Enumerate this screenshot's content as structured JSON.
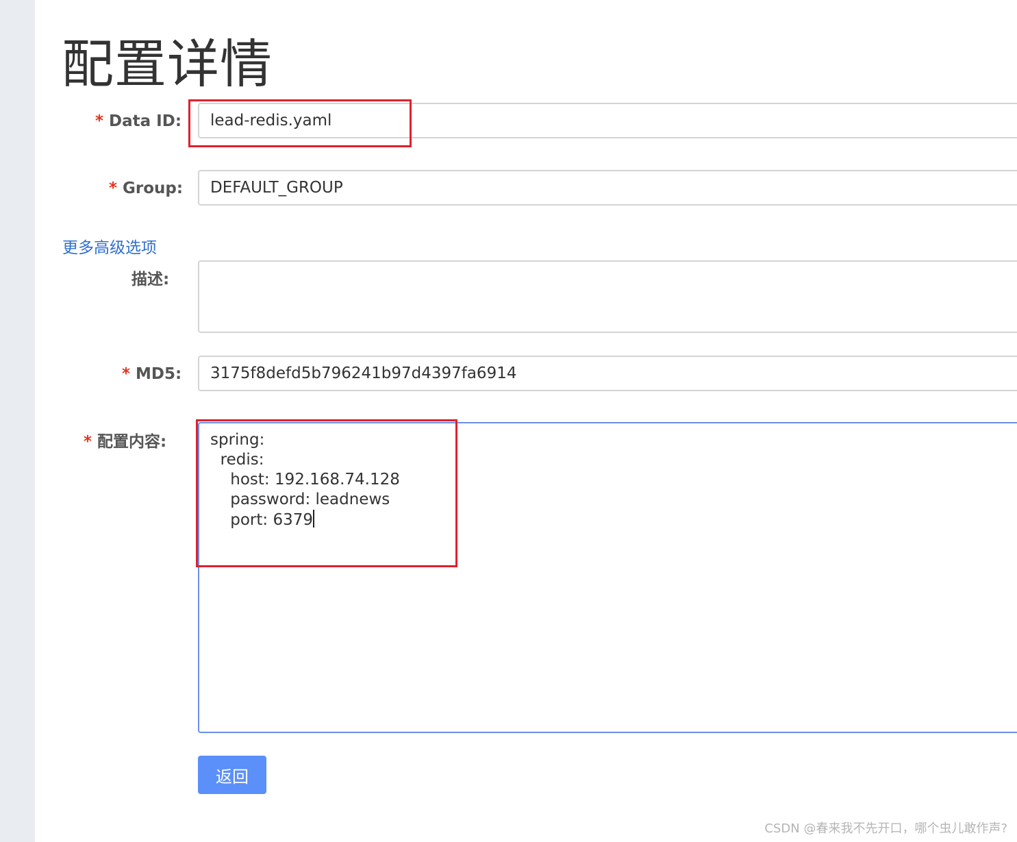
{
  "page_title": "配置详情",
  "form": {
    "data_id": {
      "required_mark": "*",
      "label": "Data ID:",
      "value": "lead-redis.yaml"
    },
    "group": {
      "required_mark": "*",
      "label": "Group:",
      "value": "DEFAULT_GROUP"
    },
    "advanced_link": "更多高级选项",
    "description": {
      "label": "描述:",
      "value": ""
    },
    "md5": {
      "required_mark": "*",
      "label": "MD5:",
      "value": "3175f8defd5b796241b97d4397fa6914"
    },
    "content": {
      "required_mark": "*",
      "label": "配置内容:",
      "lines": [
        "spring:",
        "  redis:",
        "    host: 192.168.74.128",
        "    password: leadnews",
        "    port: 6379"
      ]
    }
  },
  "actions": {
    "back_label": "返回"
  },
  "watermark": "CSDN @春来我不先开口，哪个虫儿敢作声?",
  "colors": {
    "required": "#e8321f",
    "link": "#2f6fd1",
    "primary_button": "#5b8ff9",
    "annotation": "#e0202c",
    "editor_border": "#6c8fe6"
  }
}
